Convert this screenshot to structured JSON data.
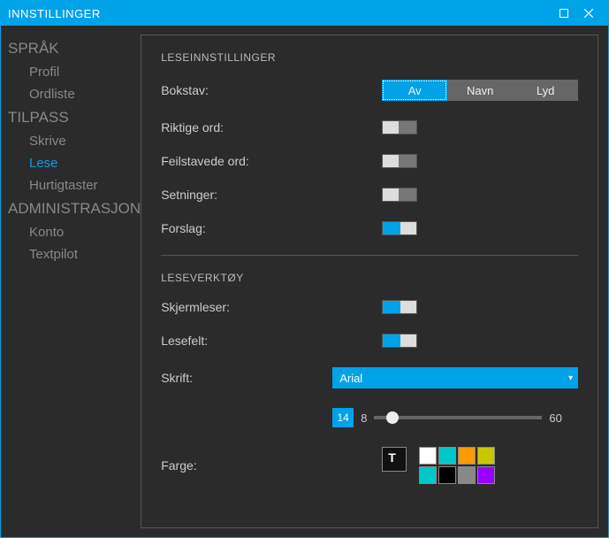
{
  "window": {
    "title": "INNSTILLINGER"
  },
  "sidebar": {
    "groups": [
      {
        "label": "SPRÅK",
        "items": [
          {
            "label": "Profil"
          },
          {
            "label": "Ordliste"
          }
        ]
      },
      {
        "label": "TILPASS",
        "items": [
          {
            "label": "Skrive"
          },
          {
            "label": "Lese",
            "active": true
          },
          {
            "label": "Hurtigtaster"
          }
        ]
      },
      {
        "label": "ADMINISTRASJON",
        "items": [
          {
            "label": "Konto"
          },
          {
            "label": "Textpilot"
          }
        ]
      }
    ]
  },
  "sections": {
    "reading": {
      "heading": "LESEINNSTILLINGER",
      "letter_label": "Bokstav:",
      "letter_options": [
        "Av",
        "Navn",
        "Lyd"
      ],
      "letter_selected": "Av",
      "correct_label": "Riktige ord:",
      "correct_on": false,
      "misspelled_label": "Feilstavede ord:",
      "misspelled_on": false,
      "sentences_label": "Setninger:",
      "sentences_on": false,
      "suggest_label": "Forslag:",
      "suggest_on": true
    },
    "tools": {
      "heading": "LESEVERKTØY",
      "screenreader_label": "Skjermleser:",
      "screenreader_on": true,
      "readfield_label": "Lesefelt:",
      "readfield_on": true,
      "font_label": "Skrift:",
      "font_value": "Arial",
      "size_current": "14",
      "size_min": "8",
      "size_max": "60",
      "color_label": "Farge:",
      "theme_glyph": "T",
      "swatches": [
        "#ffffff",
        "#00c8c8",
        "#ff9a00",
        "#c8c800",
        "#00c8c8",
        "#000000",
        "#888888",
        "#9a00ff"
      ]
    }
  }
}
